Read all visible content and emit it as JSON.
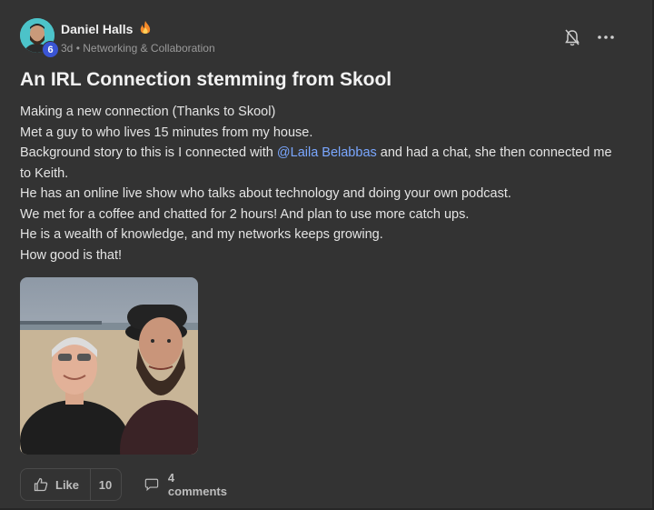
{
  "post": {
    "author": {
      "name": "Daniel Halls",
      "level": "6",
      "time_ago": "3d",
      "separator": " • ",
      "category": "Networking & Collaboration"
    },
    "title": "An IRL Connection stemming from Skool",
    "body": {
      "line1": "Making a new connection (Thanks to Skool)",
      "line2": "Met a guy to who lives 15 minutes from my house.",
      "line3_before": "Background story to this is I connected with ",
      "mention": "@Laila Belabbas",
      "line3_after": " and had a chat, she then connected me to Keith.",
      "line4": "He has an online live show who talks about technology and doing your own podcast.",
      "line5": "We met for a coffee and chatted for 2 hours! And plan to use more catch ups.",
      "line6": "He is a wealth of knowledge, and my networks keeps growing.",
      "line7": "How good is that!"
    },
    "actions": {
      "like_label": "Like",
      "like_count": "10",
      "comments_label": "4 comments"
    }
  },
  "icons": {
    "fire": "fire-icon",
    "bell": "bell-off-icon",
    "more": "more-horizontal-icon",
    "thumb": "thumbs-up-icon",
    "comment": "comment-icon"
  },
  "colors": {
    "background": "#333333",
    "mention": "#7aa7ff",
    "level_badge": "#3a55d4",
    "avatar_bg": "#4cc3c9"
  }
}
